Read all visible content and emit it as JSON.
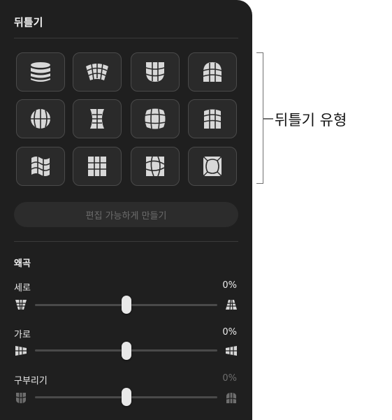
{
  "panel": {
    "title": "뒤틀기"
  },
  "warp_types": [
    {
      "icon": "cylinder-warp-icon"
    },
    {
      "icon": "arc-warp-icon"
    },
    {
      "icon": "cup-warp-icon"
    },
    {
      "icon": "arch-warp-icon"
    },
    {
      "icon": "sphere-warp-icon"
    },
    {
      "icon": "pinch-warp-icon"
    },
    {
      "icon": "bulge-warp-icon"
    },
    {
      "icon": "flag-warp-icon"
    },
    {
      "icon": "wave-warp-icon"
    },
    {
      "icon": "grid-warp-icon"
    },
    {
      "icon": "twist-warp-icon"
    },
    {
      "icon": "inflate-warp-icon"
    }
  ],
  "make_editable_label": "편집 가능하게 만들기",
  "distortion": {
    "title": "왜곡",
    "vertical": {
      "label": "세로",
      "value": "0%"
    },
    "horizontal": {
      "label": "가로",
      "value": "0%"
    },
    "bend": {
      "label": "구부리기",
      "value": "0%"
    }
  },
  "callout": {
    "label": "뒤틀기 유형"
  },
  "colors": {
    "panel": "#1f1f1f",
    "tile": "#2a2a2a",
    "tile_border": "#4a4a4a",
    "icon": "#d8d8d8"
  }
}
